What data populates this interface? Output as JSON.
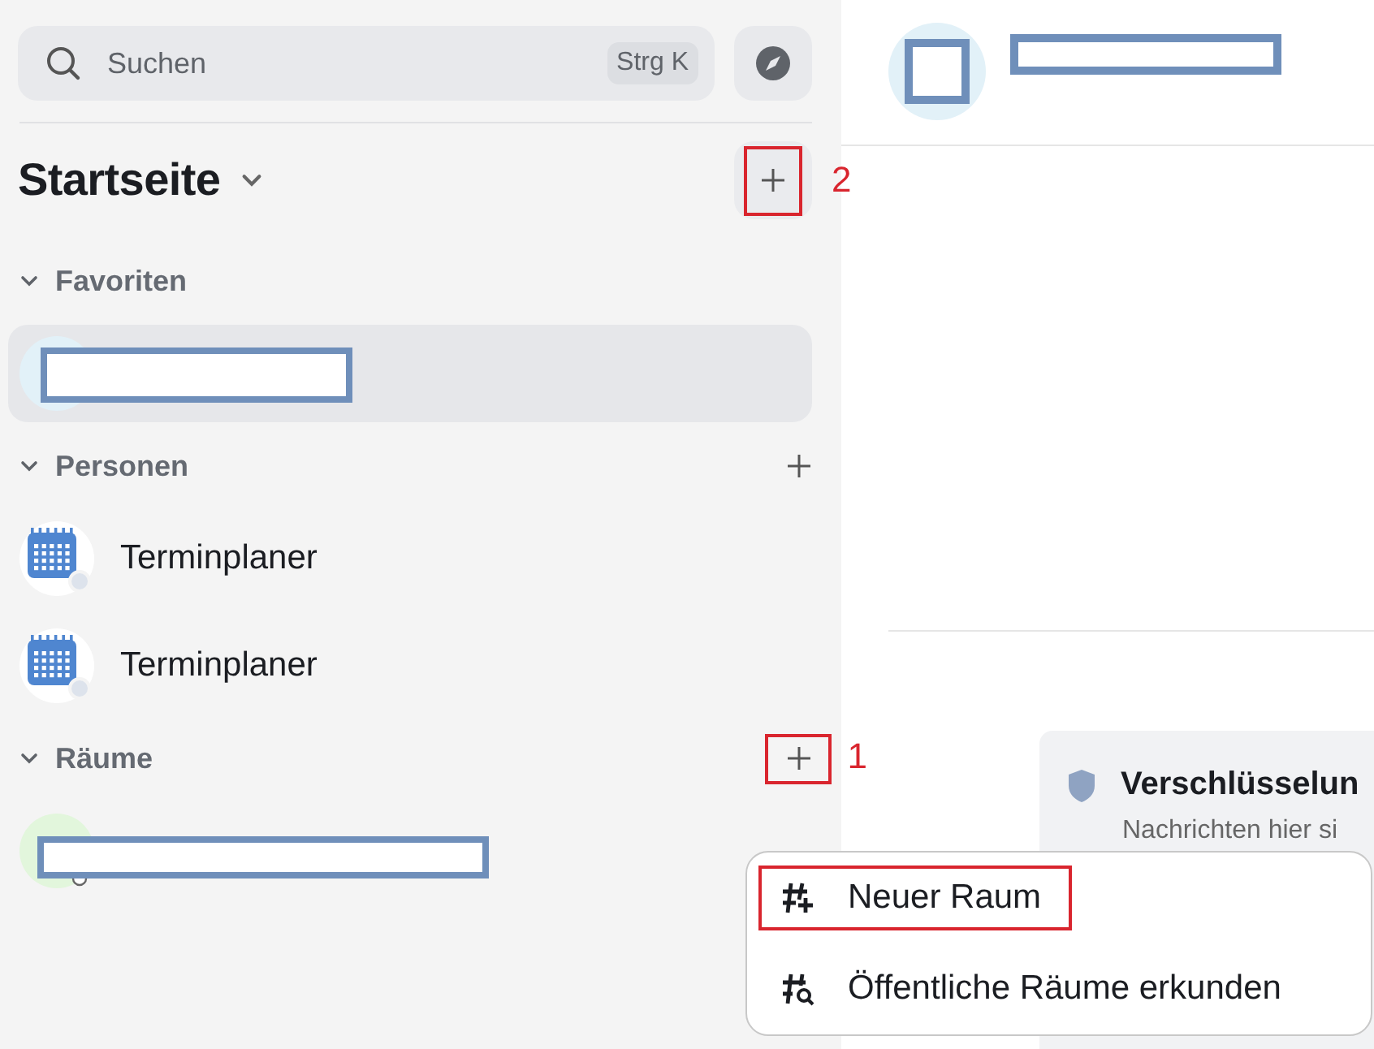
{
  "search": {
    "placeholder": "Suchen",
    "shortcut": "Strg K"
  },
  "home": {
    "title": "Startseite",
    "highlighted": true,
    "annotation": "2"
  },
  "sections": [
    {
      "title": "Favoriten",
      "expanded": true,
      "add_button": false,
      "rooms": [
        {
          "kind": "redacted",
          "selected": true
        }
      ]
    },
    {
      "title": "Personen",
      "expanded": true,
      "add_button": true,
      "rooms": [
        {
          "kind": "calendar",
          "name": "Terminplaner",
          "selected": false
        },
        {
          "kind": "calendar",
          "name": "Terminplaner",
          "selected": false
        }
      ]
    },
    {
      "title": "Räume",
      "expanded": true,
      "add_button": true,
      "highlighted": true,
      "annotation": "1",
      "rooms": [
        {
          "kind": "redacted-public",
          "selected": false
        }
      ]
    }
  ],
  "notice": {
    "title": "Verschlüsselun",
    "text": "Nachrichten hier si"
  },
  "menu": {
    "items": [
      {
        "kind": "new-room",
        "label": "Neuer Raum",
        "highlighted": true
      },
      {
        "kind": "explore",
        "label": "Öffentliche Räume erkunden",
        "highlighted": false
      }
    ]
  }
}
